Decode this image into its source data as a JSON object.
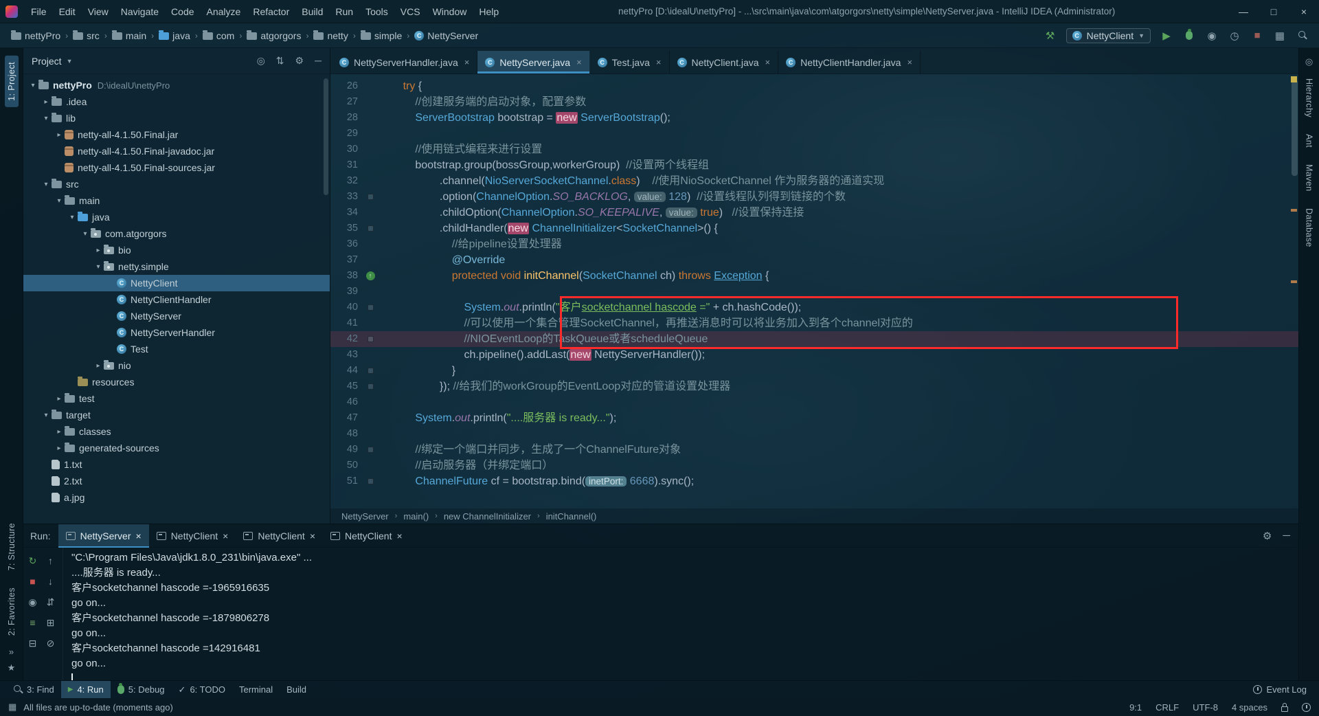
{
  "window": {
    "title": "nettyPro [D:\\idealU\\nettyPro] - ...\\src\\main\\java\\com\\atgorgors\\netty\\simple\\NettyServer.java - IntelliJ IDEA (Administrator)",
    "controls": [
      {
        "name": "minimize-button",
        "glyph": "—"
      },
      {
        "name": "maximize-button",
        "glyph": "□"
      },
      {
        "name": "close-button",
        "glyph": "×"
      }
    ]
  },
  "menu": [
    "File",
    "Edit",
    "View",
    "Navigate",
    "Code",
    "Analyze",
    "Refactor",
    "Build",
    "Run",
    "Tools",
    "VCS",
    "Window",
    "Help"
  ],
  "navbar": {
    "breadcrumb": [
      {
        "label": "nettyPro",
        "icon": "folder"
      },
      {
        "label": "src",
        "icon": "folder"
      },
      {
        "label": "main",
        "icon": "folder"
      },
      {
        "label": "java",
        "icon": "folder-src"
      },
      {
        "label": "com",
        "icon": "folder"
      },
      {
        "label": "atgorgors",
        "icon": "folder"
      },
      {
        "label": "netty",
        "icon": "folder"
      },
      {
        "label": "simple",
        "icon": "folder"
      },
      {
        "label": "NettyServer",
        "icon": "class"
      }
    ],
    "run_config": "NettyClient",
    "tools_right": [
      "run-icon",
      "debug-icon",
      "coverage-icon",
      "profiler-icon",
      "stop-icon",
      "layout-icon",
      "search-icon"
    ]
  },
  "project": {
    "header": {
      "title": "Project",
      "icons": [
        "locate-icon",
        "collapse-all-icon",
        "settings-icon",
        "hide-icon"
      ]
    },
    "tree": [
      {
        "label": "nettyPro",
        "sub": "D:\\idealU\\nettyPro",
        "lvl": 0,
        "arrow": "open",
        "icon": "folder",
        "bold": true
      },
      {
        "label": ".idea",
        "lvl": 1,
        "arrow": "closed",
        "icon": "folder"
      },
      {
        "label": "lib",
        "lvl": 1,
        "arrow": "open",
        "icon": "folder"
      },
      {
        "label": "netty-all-4.1.50.Final.jar",
        "lvl": 2,
        "arrow": "closed",
        "icon": "jar"
      },
      {
        "label": "netty-all-4.1.50.Final-javadoc.jar",
        "lvl": 2,
        "arrow": null,
        "icon": "jar"
      },
      {
        "label": "netty-all-4.1.50.Final-sources.jar",
        "lvl": 2,
        "arrow": null,
        "icon": "jar"
      },
      {
        "label": "src",
        "lvl": 1,
        "arrow": "open",
        "icon": "folder"
      },
      {
        "label": "main",
        "lvl": 2,
        "arrow": "open",
        "icon": "folder"
      },
      {
        "label": "java",
        "lvl": 3,
        "arrow": "open",
        "icon": "folder-src"
      },
      {
        "label": "com.atgorgors",
        "lvl": 4,
        "arrow": "open",
        "icon": "package"
      },
      {
        "label": "bio",
        "lvl": 5,
        "arrow": "closed",
        "icon": "package"
      },
      {
        "label": "netty.simple",
        "lvl": 5,
        "arrow": "open",
        "icon": "package"
      },
      {
        "label": "NettyClient",
        "lvl": 6,
        "arrow": null,
        "icon": "class",
        "selected": true
      },
      {
        "label": "NettyClientHandler",
        "lvl": 6,
        "arrow": null,
        "icon": "class"
      },
      {
        "label": "NettyServer",
        "lvl": 6,
        "arrow": null,
        "icon": "class"
      },
      {
        "label": "NettyServerHandler",
        "lvl": 6,
        "arrow": null,
        "icon": "class"
      },
      {
        "label": "Test",
        "lvl": 6,
        "arrow": null,
        "icon": "class"
      },
      {
        "label": "nio",
        "lvl": 5,
        "arrow": "closed",
        "icon": "package"
      },
      {
        "label": "resources",
        "lvl": 3,
        "arrow": null,
        "icon": "folder-res"
      },
      {
        "label": "test",
        "lvl": 2,
        "arrow": "closed",
        "icon": "folder"
      },
      {
        "label": "target",
        "lvl": 1,
        "arrow": "open",
        "icon": "folder"
      },
      {
        "label": "classes",
        "lvl": 2,
        "arrow": "closed",
        "icon": "folder"
      },
      {
        "label": "generated-sources",
        "lvl": 2,
        "arrow": "closed",
        "icon": "folder"
      },
      {
        "label": "1.txt",
        "lvl": 1,
        "arrow": null,
        "icon": "file"
      },
      {
        "label": "2.txt",
        "lvl": 1,
        "arrow": null,
        "icon": "file"
      },
      {
        "label": "a.jpg",
        "lvl": 1,
        "arrow": null,
        "icon": "file"
      }
    ]
  },
  "editor": {
    "tabs": [
      {
        "label": "NettyServerHandler.java",
        "active": false
      },
      {
        "label": "NettyServer.java",
        "active": true
      },
      {
        "label": "Test.java",
        "active": false
      },
      {
        "label": "NettyClient.java",
        "active": false
      },
      {
        "label": "NettyClientHandler.java",
        "active": false
      }
    ],
    "breadcrumbs": [
      "NettyServer",
      "main()",
      "new ChannelInitializer",
      "initChannel()"
    ]
  },
  "code": {
    "current_line": 42,
    "annotated_lines": "40-42",
    "lines": [
      {
        "n": 26,
        "g": null,
        "hl": false,
        "segs": [
          [
            "pl",
            "        "
          ],
          [
            "kw",
            "try"
          ],
          [
            "pl",
            " {"
          ]
        ]
      },
      {
        "n": 27,
        "g": null,
        "hl": false,
        "segs": [
          [
            "cmt",
            "            //创建服务端的启动对象，配置参数"
          ]
        ]
      },
      {
        "n": 28,
        "g": null,
        "hl": false,
        "segs": [
          [
            "pl",
            "            "
          ],
          [
            "cls",
            "ServerBootstrap"
          ],
          [
            "pl",
            " bootstrap = "
          ],
          [
            "new",
            "new"
          ],
          [
            "pl",
            " "
          ],
          [
            "cls",
            "ServerBootstrap"
          ],
          [
            "pl",
            "();"
          ]
        ]
      },
      {
        "n": 29,
        "g": null,
        "hl": false,
        "segs": []
      },
      {
        "n": 30,
        "g": null,
        "hl": false,
        "segs": [
          [
            "cmt",
            "            //使用链式编程来进行设置"
          ]
        ]
      },
      {
        "n": 31,
        "g": null,
        "hl": false,
        "segs": [
          [
            "pl",
            "            bootstrap.group(bossGroup,workerGroup)  "
          ],
          [
            "cmt",
            "//设置两个线程组"
          ]
        ]
      },
      {
        "n": 32,
        "g": null,
        "hl": false,
        "segs": [
          [
            "pl",
            "                    .channel("
          ],
          [
            "cls",
            "NioServerSocketChannel"
          ],
          [
            "pl",
            "."
          ],
          [
            "kw",
            "class"
          ],
          [
            "pl",
            ")    "
          ],
          [
            "cmt",
            "//使用NioSocketChannel 作为服务器的通道实现"
          ]
        ]
      },
      {
        "n": 33,
        "g": "mark",
        "hl": false,
        "segs": [
          [
            "pl",
            "                    .option("
          ],
          [
            "cls",
            "ChannelOption"
          ],
          [
            "pl",
            "."
          ],
          [
            "fld",
            "SO_BACKLOG"
          ],
          [
            "pl",
            ", "
          ],
          [
            "hint",
            "value:"
          ],
          [
            "pl",
            " "
          ],
          [
            "num",
            "128"
          ],
          [
            "pl",
            ")  "
          ],
          [
            "cmt",
            "//设置线程队列得到链接的个数"
          ]
        ]
      },
      {
        "n": 34,
        "g": null,
        "hl": false,
        "segs": [
          [
            "pl",
            "                    .childOption("
          ],
          [
            "cls",
            "ChannelOption"
          ],
          [
            "pl",
            "."
          ],
          [
            "fld",
            "SO_KEEPALIVE"
          ],
          [
            "pl",
            ", "
          ],
          [
            "hint",
            "value:"
          ],
          [
            "pl",
            " "
          ],
          [
            "kw",
            "true"
          ],
          [
            "pl",
            ")   "
          ],
          [
            "cmt",
            "//设置保持连接"
          ]
        ]
      },
      {
        "n": 35,
        "g": "mark",
        "hl": false,
        "segs": [
          [
            "pl",
            "                    .childHandler("
          ],
          [
            "new",
            "new"
          ],
          [
            "pl",
            " "
          ],
          [
            "cls",
            "ChannelInitializer"
          ],
          [
            "pl",
            "<"
          ],
          [
            "cls",
            "SocketChannel"
          ],
          [
            "pl",
            ">() {"
          ]
        ]
      },
      {
        "n": 36,
        "g": null,
        "hl": false,
        "segs": [
          [
            "cmt",
            "                        //给pipeline设置处理器"
          ]
        ]
      },
      {
        "n": 37,
        "g": null,
        "hl": false,
        "segs": [
          [
            "pl",
            "                        "
          ],
          [
            "ann",
            "@Override"
          ]
        ]
      },
      {
        "n": 38,
        "g": "override",
        "hl": false,
        "segs": [
          [
            "pl",
            "                        "
          ],
          [
            "kw",
            "protected"
          ],
          [
            "pl",
            " "
          ],
          [
            "kw",
            "void"
          ],
          [
            "pl",
            " "
          ],
          [
            "mth",
            "initChannel"
          ],
          [
            "pl",
            "("
          ],
          [
            "cls",
            "SocketChannel"
          ],
          [
            "pl",
            " ch) "
          ],
          [
            "kw",
            "throws"
          ],
          [
            "pl",
            " "
          ],
          [
            "clsu",
            "Exception"
          ],
          [
            "pl",
            " {"
          ]
        ]
      },
      {
        "n": 39,
        "g": null,
        "hl": false,
        "segs": []
      },
      {
        "n": 40,
        "g": "mark",
        "hl": false,
        "segs": [
          [
            "pl",
            "                            "
          ],
          [
            "cls",
            "System"
          ],
          [
            "pl",
            "."
          ],
          [
            "fld",
            "out"
          ],
          [
            "pl",
            ".println("
          ],
          [
            "str",
            "\"客户"
          ],
          [
            "stru",
            "socketchannel hascode"
          ],
          [
            "str",
            " =\""
          ],
          [
            "pl",
            " + ch.hashCode());"
          ]
        ]
      },
      {
        "n": 41,
        "g": null,
        "hl": false,
        "segs": [
          [
            "cmt",
            "                            //可以使用一个集合管理SocketChannel，再推送消息时可以将业务加入到各个channel对应的"
          ]
        ]
      },
      {
        "n": 42,
        "g": "mark",
        "hl": true,
        "segs": [
          [
            "cmt",
            "                            //NIOEventLoop的TaskQueue或者scheduleQueue"
          ]
        ]
      },
      {
        "n": 43,
        "g": null,
        "hl": false,
        "segs": [
          [
            "pl",
            "                            ch.pipeline().addLast("
          ],
          [
            "new",
            "new"
          ],
          [
            "pl",
            " NettyServerHandler());"
          ]
        ]
      },
      {
        "n": 44,
        "g": "mark",
        "hl": false,
        "segs": [
          [
            "pl",
            "                        }"
          ]
        ]
      },
      {
        "n": 45,
        "g": "mark",
        "hl": false,
        "segs": [
          [
            "pl",
            "                    }); "
          ],
          [
            "cmt",
            "//给我们的workGroup的EventLoop对应的管道设置处理器"
          ]
        ]
      },
      {
        "n": 46,
        "g": null,
        "hl": false,
        "segs": []
      },
      {
        "n": 47,
        "g": null,
        "hl": false,
        "segs": [
          [
            "pl",
            "            "
          ],
          [
            "cls",
            "System"
          ],
          [
            "pl",
            "."
          ],
          [
            "fld",
            "out"
          ],
          [
            "pl",
            ".println("
          ],
          [
            "str",
            "\"....服务器 is ready...\""
          ],
          [
            "pl",
            ");"
          ]
        ]
      },
      {
        "n": 48,
        "g": null,
        "hl": false,
        "segs": []
      },
      {
        "n": 49,
        "g": "mark",
        "hl": false,
        "segs": [
          [
            "cmt",
            "            //绑定一个端口并同步，生成了一个ChannelFuture对象"
          ]
        ]
      },
      {
        "n": 50,
        "g": null,
        "hl": false,
        "segs": [
          [
            "cmt",
            "            //启动服务器（并绑定端口）"
          ]
        ]
      },
      {
        "n": 51,
        "g": "mark",
        "hl": false,
        "segs": [
          [
            "pl",
            "            "
          ],
          [
            "cls",
            "ChannelFuture"
          ],
          [
            "pl",
            " cf = bootstrap.bind("
          ],
          [
            "hintsel",
            "inetPort:"
          ],
          [
            "pl",
            " "
          ],
          [
            "num",
            "6668"
          ],
          [
            "pl",
            ").sync();"
          ]
        ]
      }
    ]
  },
  "run": {
    "label": "Run:",
    "tabs": [
      {
        "label": "NettyServer",
        "active": true
      },
      {
        "label": "NettyClient",
        "active": false
      },
      {
        "label": "NettyClient",
        "active": false
      },
      {
        "label": "NettyClient",
        "active": false
      }
    ],
    "header_icons": [
      "settings-icon",
      "hide-icon"
    ],
    "toolbar": [
      {
        "name": "rerun-icon",
        "glyph": "↻",
        "color": "#5BA35B"
      },
      {
        "name": "up-stack-icon",
        "glyph": "↑",
        "color": "#8ea3ad"
      },
      {
        "name": "stop-icon",
        "glyph": "■",
        "color": "#C75450"
      },
      {
        "name": "down-stack-icon",
        "glyph": "↓",
        "color": "#8ea3ad"
      },
      {
        "name": "dump-threads-icon",
        "glyph": "◉",
        "color": "#8ea3ad"
      },
      {
        "name": "history-icon",
        "glyph": "⇵",
        "color": "#8ea3ad"
      },
      {
        "name": "soft-wrap-icon",
        "glyph": "≡",
        "color": "#7FAF6F"
      },
      {
        "name": "restore-layout-icon",
        "glyph": "⊞",
        "color": "#8ea3ad"
      },
      {
        "name": "print-icon",
        "glyph": "⊟",
        "color": "#8ea3ad"
      },
      {
        "name": "clear-icon",
        "glyph": "⊘",
        "color": "#8ea3ad"
      }
    ],
    "console_lines": [
      "\"C:\\Program Files\\Java\\jdk1.8.0_231\\bin\\java.exe\" ...",
      "....服务器 is ready...",
      "客户socketchannel hascode =-1965916635",
      "go on...",
      "客户socketchannel hascode =-1879806278",
      "go on...",
      "客户socketchannel hascode =142916481",
      "go on..."
    ]
  },
  "bottom_bar": {
    "items": [
      {
        "label": "3: Find",
        "icon": "find-icon",
        "active": false
      },
      {
        "label": "4: Run",
        "icon": "run-icon",
        "active": true
      },
      {
        "label": "5: Debug",
        "icon": "debug-icon",
        "active": false
      },
      {
        "label": "6: TODO",
        "icon": "todo-icon",
        "active": false
      },
      {
        "label": "Terminal",
        "icon": null,
        "active": false
      },
      {
        "label": "Build",
        "icon": null,
        "active": false
      }
    ],
    "right": {
      "label": "Event Log",
      "icon": "event-log-icon"
    }
  },
  "status_bar": {
    "left": "All files are up-to-date (moments ago)",
    "right": [
      "9:1",
      "CRLF",
      "UTF-8",
      "4 spaces"
    ],
    "right_icons": [
      "lock-icon",
      "memory-icon"
    ]
  },
  "stripes": {
    "left": {
      "items": [
        {
          "label": "1: Project",
          "active": true
        },
        {
          "label": "7: Structure",
          "active": false
        },
        {
          "label": "2: Favorites",
          "active": false
        }
      ],
      "bottom_icons": [
        {
          "name": "more-icon",
          "glyph": "»"
        },
        {
          "name": "favorites-star-icon",
          "glyph": "★"
        }
      ]
    },
    "right": {
      "top_icon": {
        "name": "notifications-icon",
        "glyph": "◎"
      },
      "items": [
        {
          "label": "Hierarchy"
        },
        {
          "label": "Ant"
        },
        {
          "label": "Maven"
        },
        {
          "label": "Database"
        }
      ]
    }
  },
  "colors": {
    "accent": "#3D8FC4",
    "annotation_red": "#FF2B2B",
    "keyword_orange": "#CC7832",
    "string_green": "#7CBE5D",
    "selection_blue": "#2F5F80",
    "run_green": "#5BA35B",
    "stop_red": "#C75450"
  }
}
